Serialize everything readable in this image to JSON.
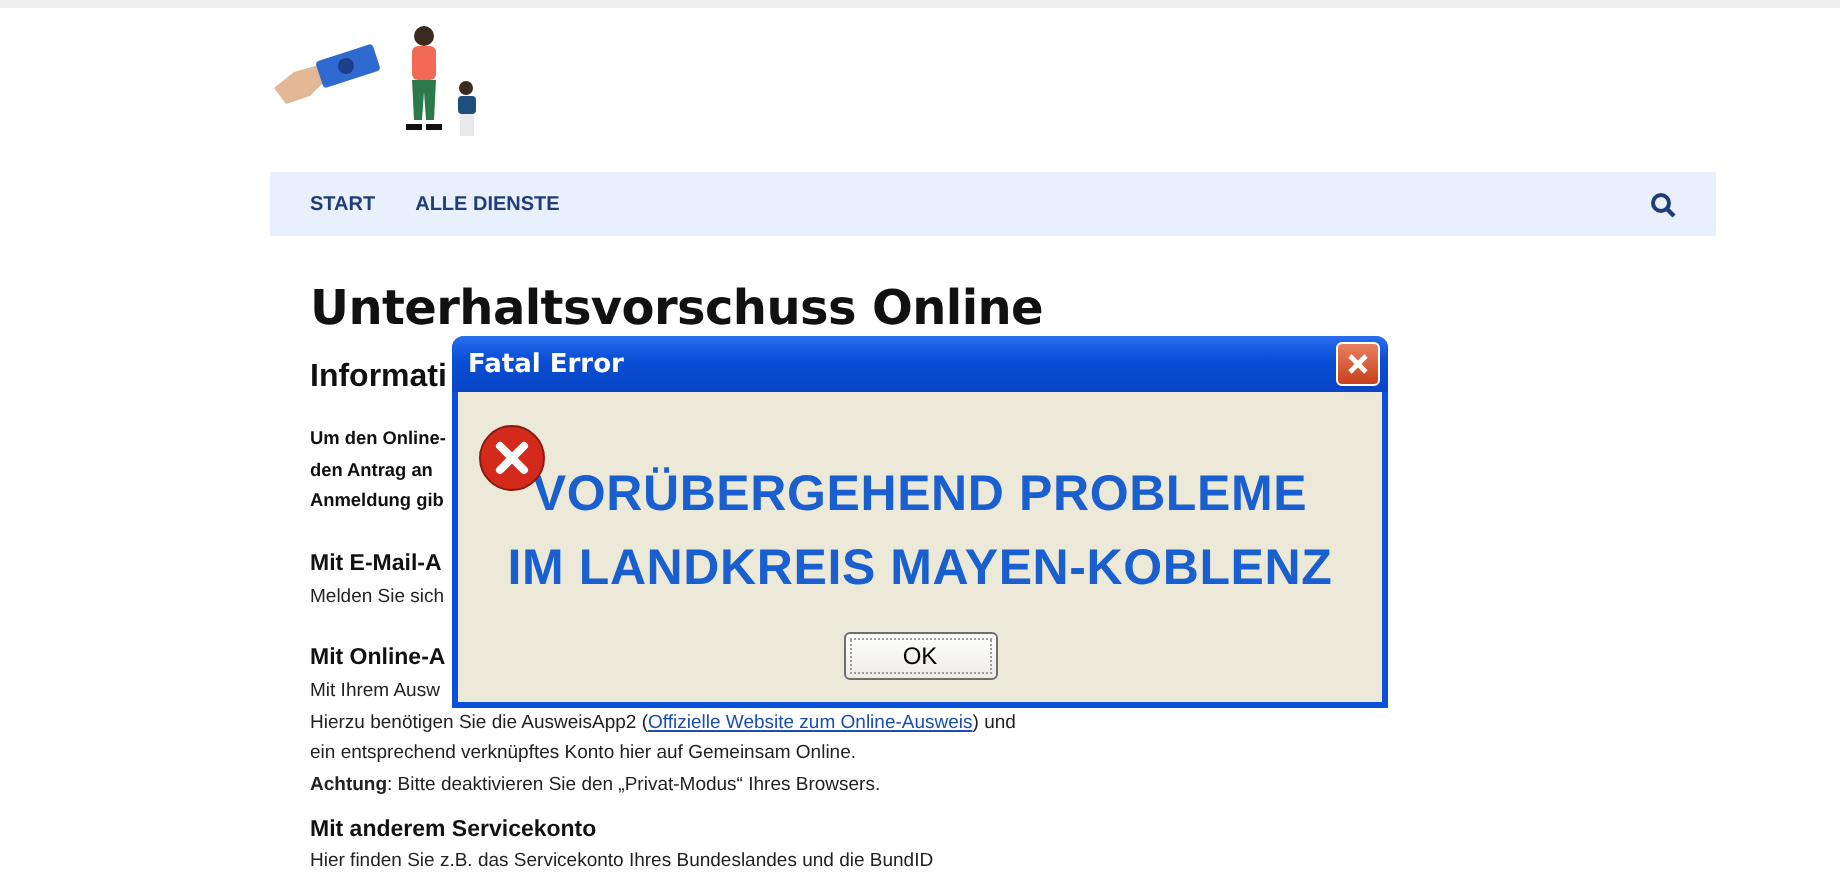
{
  "nav": {
    "items": [
      {
        "label": "START"
      },
      {
        "label": "ALLE DIENSTE"
      }
    ]
  },
  "page": {
    "title": "Unterhaltsvorschuss Online",
    "blocks": [
      {
        "kind": "heading2",
        "lines": [
          "Informati"
        ]
      },
      {
        "kind": "intro",
        "lines": [
          "Um den Online-",
          "den Antrag an",
          "Anmeldung gib"
        ]
      },
      {
        "kind": "heading3",
        "lines": [
          "Mit E-Mail-A"
        ]
      },
      {
        "kind": "paragraph",
        "lines": [
          "Melden Sie sich"
        ]
      },
      {
        "kind": "heading3",
        "lines": [
          "Mit Online-A"
        ]
      },
      {
        "kind": "paragraph",
        "lines": [
          "Mit Ihrem Ausw"
        ]
      },
      {
        "kind": "linkline",
        "before": "Hierzu benötigen Sie die AusweisApp2 (",
        "link": "Offizielle Website zum Online-Ausweis",
        "after": ") und"
      },
      {
        "kind": "paragraph",
        "lines": [
          "ein entsprechend verknüpftes Konto hier auf Gemeinsam Online.",
          "**Achtung**: Bitte deaktivieren Sie den „Privat-Modus“ Ihres Browsers."
        ]
      },
      {
        "kind": "heading3",
        "lines": [
          "Mit anderem Servicekonto"
        ]
      },
      {
        "kind": "paragraph",
        "lines": [
          "Hier finden Sie z.B. das Servicekonto Ihres Bundeslandes und die BundID"
        ]
      }
    ]
  },
  "dialog": {
    "title": "Fatal Error",
    "message_lines": [
      "VORÜBERGEHEND PROBLEME",
      "IM LANDKREIS MAYEN-KOBLENZ"
    ],
    "button": "OK"
  }
}
